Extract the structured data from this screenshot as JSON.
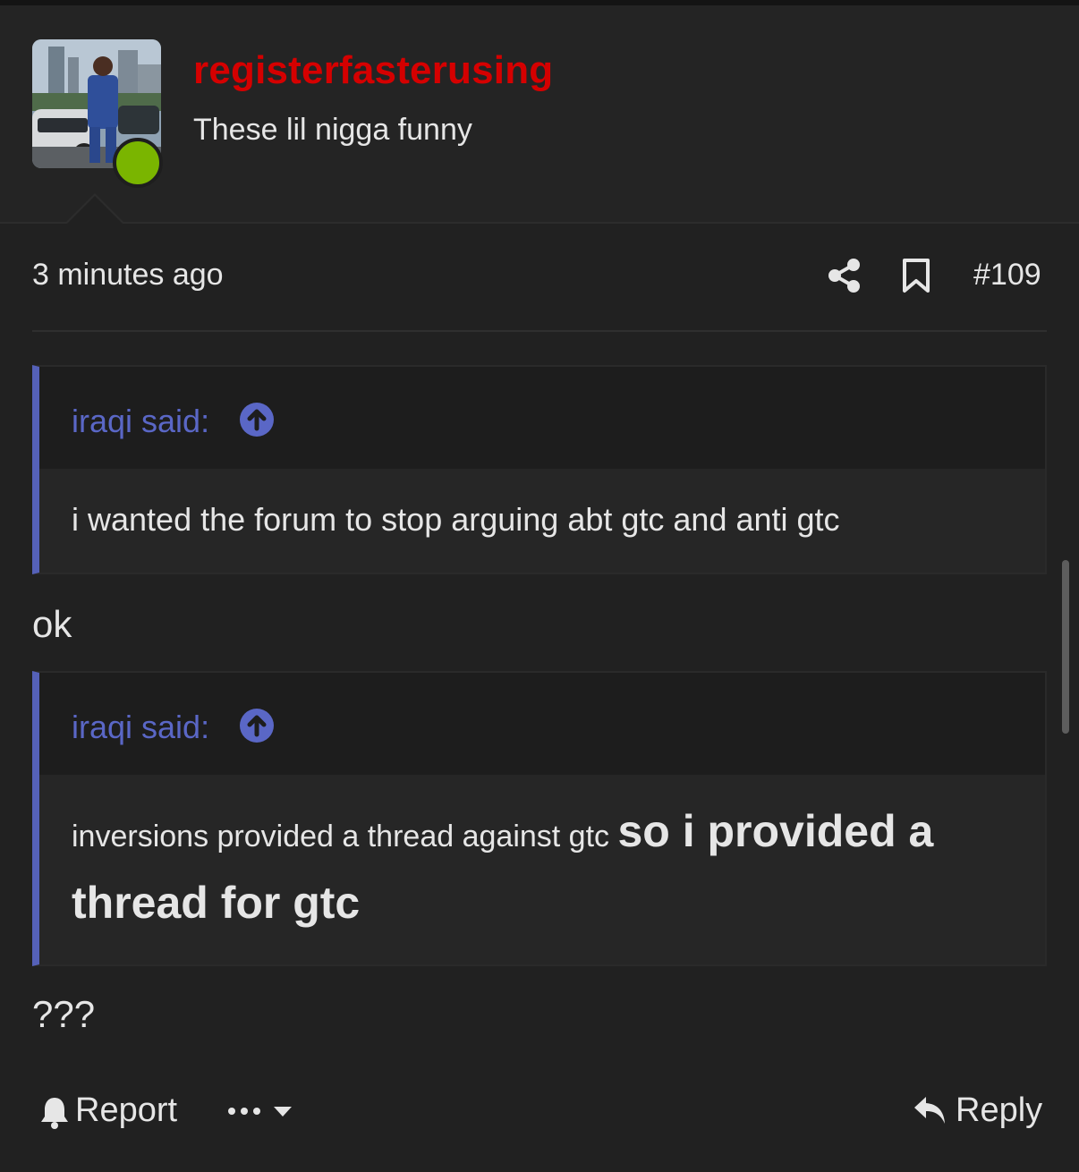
{
  "post": {
    "username": "registerfasterusing",
    "user_title": "These lil nigga funny",
    "time": "3 minutes ago",
    "post_number": "#109",
    "online_status_color": "#7ab500",
    "username_color": "#d50000"
  },
  "quotes": [
    {
      "author": "iraqi said:",
      "text": "i wanted the forum to stop arguing abt gtc and anti gtc"
    },
    {
      "author": "iraqi said:",
      "text_normal": "inversions provided a thread against gtc ",
      "text_bold": "so i provided a thread for gtc"
    }
  ],
  "replies": [
    "ok",
    "???"
  ],
  "footer": {
    "report_label": "Report",
    "reply_label": "Reply"
  },
  "icons": [
    "share-icon",
    "bookmark-icon",
    "arrow-up-circle-icon",
    "bell-icon",
    "more-dots-icon",
    "caret-down-icon",
    "reply-icon"
  ],
  "colors": {
    "background": "#212121",
    "quote_accent": "#5561b8",
    "quote_author": "#5a67c6"
  }
}
